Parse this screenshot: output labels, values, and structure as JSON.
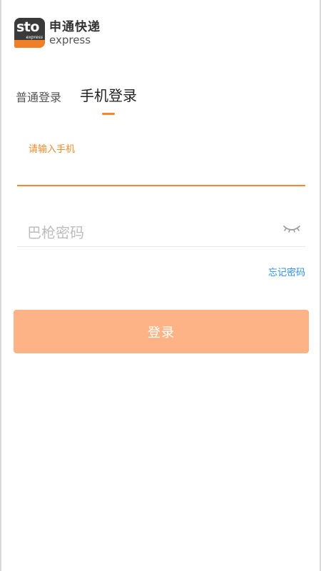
{
  "logo": {
    "mark_text": "sto",
    "mark_subtext": "express",
    "name_cn": "申通快递",
    "name_en": "express"
  },
  "tabs": [
    {
      "label": "普通登录",
      "active": false
    },
    {
      "label": "手机登录",
      "active": true
    }
  ],
  "phone_field": {
    "label": "请输入手机",
    "value": ""
  },
  "password_field": {
    "placeholder": "巴枪密码",
    "value": "",
    "toggle_icon": "eye-closed-icon"
  },
  "forgot_link": "忘记密码",
  "login_button": "登录",
  "colors": {
    "accent": "#f08a2c",
    "button": "#fdb385",
    "link": "#2f8fe8"
  }
}
